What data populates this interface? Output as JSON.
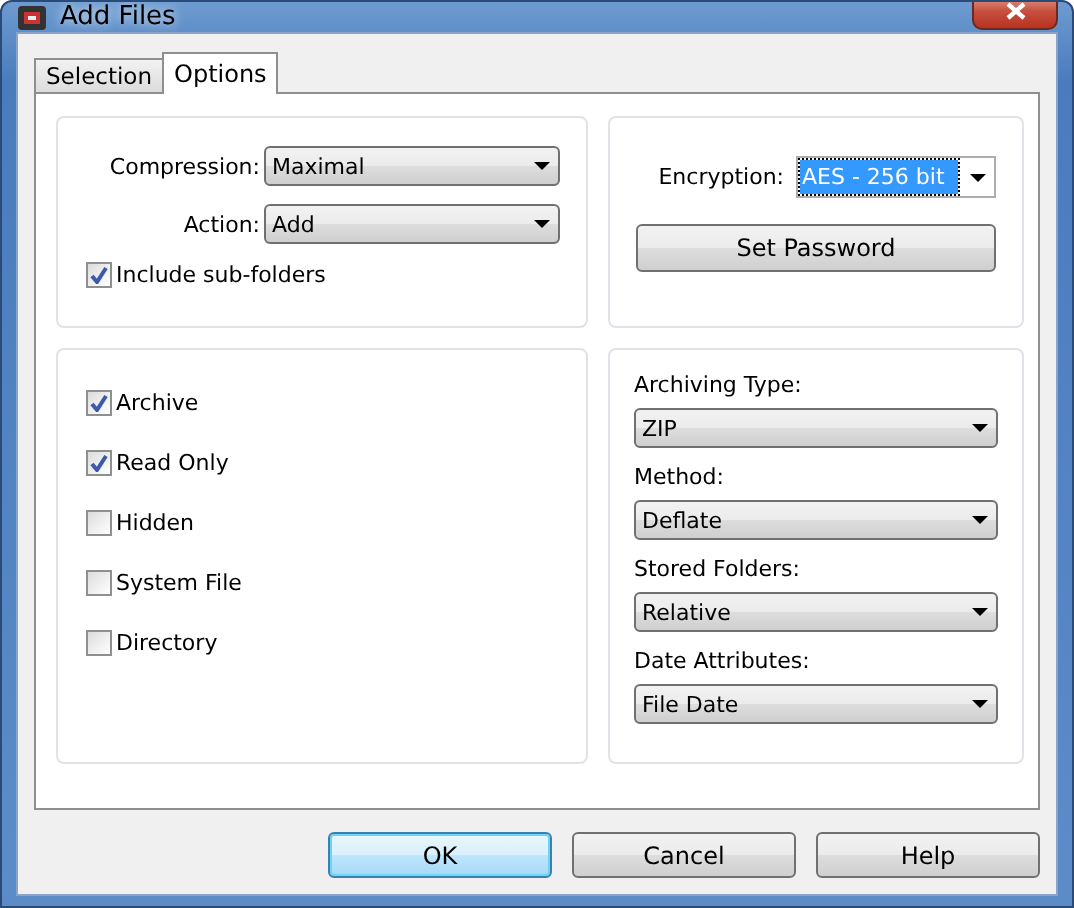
{
  "window": {
    "title": "Add Files"
  },
  "tabs": [
    {
      "label": "Selection",
      "selected": false
    },
    {
      "label": "Options",
      "selected": true
    }
  ],
  "compression": {
    "label": "Compression:",
    "value": "Maximal"
  },
  "action": {
    "label": "Action:",
    "value": "Add"
  },
  "include_subfolders": {
    "label": "Include sub-folders",
    "checked": true
  },
  "encryption": {
    "label": "Encryption:",
    "value": "AES - 256 bit",
    "focused": true
  },
  "set_password": "Set Password",
  "attributes": [
    {
      "label": "Archive",
      "checked": true
    },
    {
      "label": "Read Only",
      "checked": true
    },
    {
      "label": "Hidden",
      "checked": false
    },
    {
      "label": "System File",
      "checked": false
    },
    {
      "label": "Directory",
      "checked": false
    }
  ],
  "settings": [
    {
      "label": "Archiving Type:",
      "value": "ZIP"
    },
    {
      "label": "Method:",
      "value": "Deflate"
    },
    {
      "label": "Stored Folders:",
      "value": "Relative"
    },
    {
      "label": "Date Attributes:",
      "value": "File Date"
    }
  ],
  "buttons": [
    {
      "label": "OK",
      "default": true
    },
    {
      "label": "Cancel",
      "default": false
    },
    {
      "label": "Help",
      "default": false
    }
  ]
}
